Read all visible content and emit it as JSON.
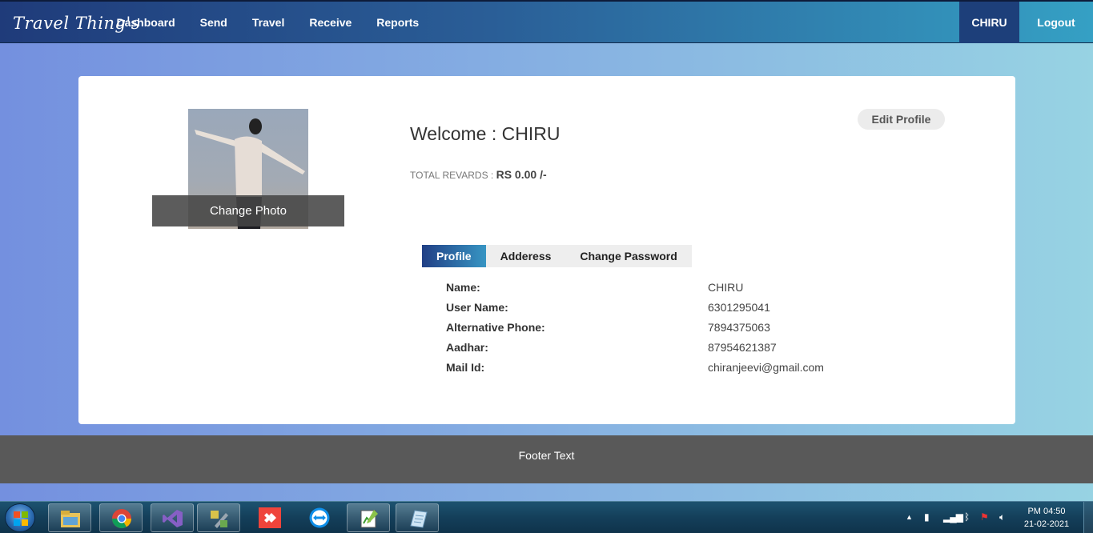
{
  "navbar": {
    "brand": "Travel Thing's",
    "links": [
      "Dashboard",
      "Send",
      "Travel",
      "Receive",
      "Reports"
    ],
    "user": "CHIRU",
    "logout": "Logout"
  },
  "profile": {
    "change_photo": "Change Photo",
    "welcome": "Welcome : CHIRU",
    "rewards_label": "TOTAL REVARDS :",
    "rewards_value": "RS 0.00 /-",
    "edit_profile": "Edit Profile",
    "tabs": [
      "Profile",
      "Adderess",
      "Change Password"
    ],
    "active_tab": "Profile",
    "details": [
      {
        "label": "Name:",
        "value": "CHIRU"
      },
      {
        "label": "User Name:",
        "value": "6301295041"
      },
      {
        "label": "Alternative Phone:",
        "value": "7894375063"
      },
      {
        "label": "Aadhar:",
        "value": "87954621387"
      },
      {
        "label": "Mail Id:",
        "value": "chiranjeevi@gmail.com"
      }
    ]
  },
  "footer": {
    "text": "Footer Text"
  },
  "taskbar": {
    "apps": [
      "file-explorer-icon",
      "chrome-icon",
      "visual-studio-icon",
      "tools-icon",
      "anydesk-icon",
      "teamviewer-icon",
      "notepad-plus-icon",
      "notes-icon"
    ],
    "clock_time": "PM 04:50",
    "clock_date": "21-02-2021"
  },
  "colors": {
    "nav_start": "#1f3b7a",
    "nav_end": "#35a0c4",
    "active_tab_start": "#213f85",
    "active_tab_end": "#3795c3",
    "footer": "#595959"
  }
}
